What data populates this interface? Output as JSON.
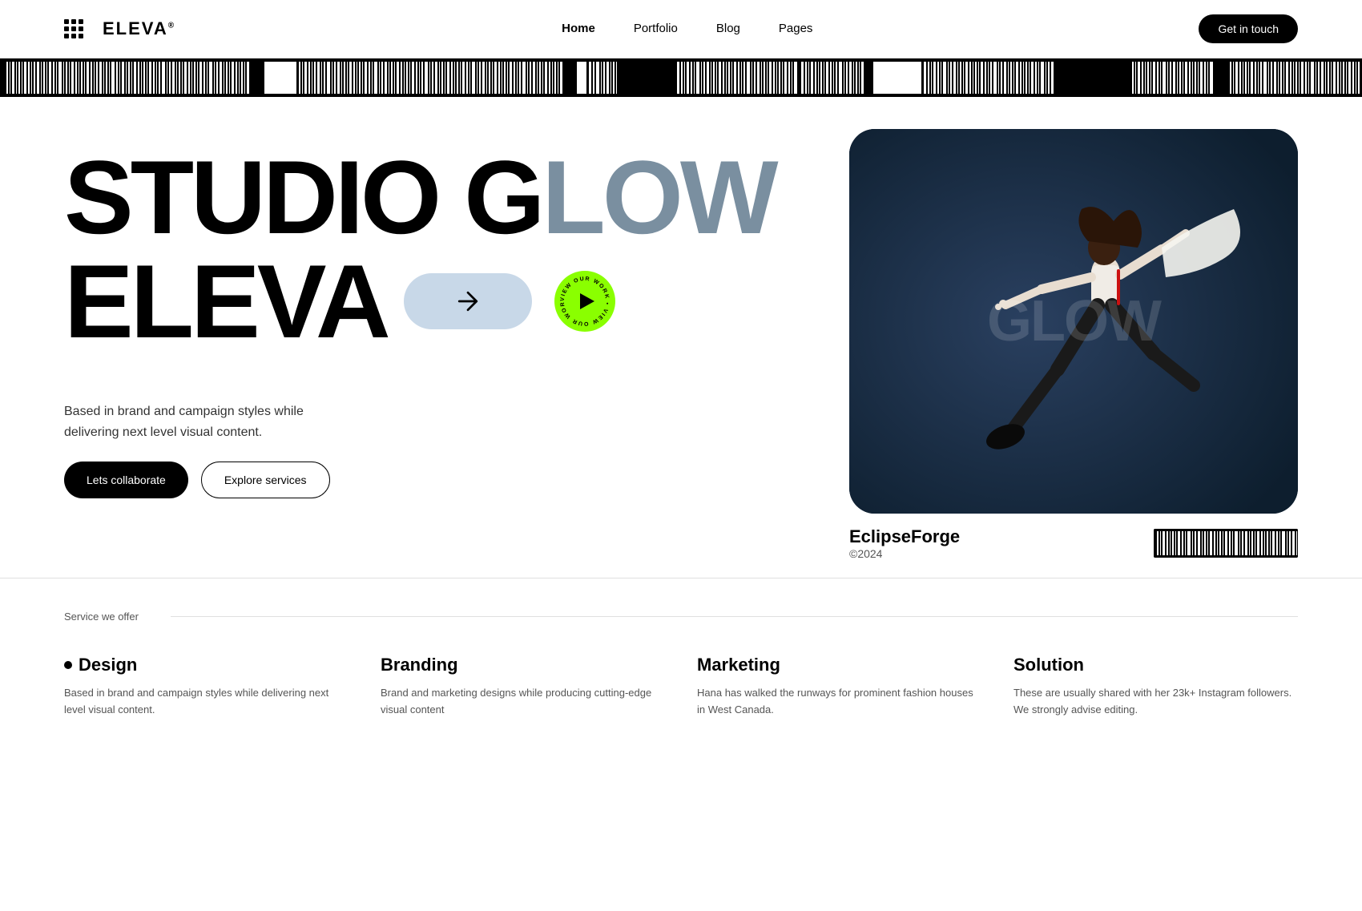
{
  "nav": {
    "logo": "ELEVA",
    "logo_sup": "®",
    "links": [
      {
        "label": "Home",
        "active": true
      },
      {
        "label": "Portfolio",
        "active": false
      },
      {
        "label": "Blog",
        "active": false
      },
      {
        "label": "Pages",
        "active": false
      }
    ],
    "cta_label": "Get in touch"
  },
  "hero": {
    "title_line1_part1": "STUDIO G",
    "title_line1_part2": "LOW",
    "title_line2": "ELEVA",
    "description": "Based in brand and campaign styles while delivering next level visual content.",
    "btn_collaborate": "Lets collaborate",
    "btn_services": "Explore services",
    "play_badge_text": "VIEW OUR WORK",
    "image_caption_title": "EclipseForge",
    "image_caption_year": "©2024",
    "image_overlay_text": "GLOW"
  },
  "services": {
    "section_label": "Service we offer",
    "items": [
      {
        "title": "Design",
        "has_bullet": true,
        "desc": "Based in brand and campaign styles while delivering next level visual content."
      },
      {
        "title": "Branding",
        "has_bullet": false,
        "desc": "Brand and marketing designs while producing cutting-edge visual content"
      },
      {
        "title": "Marketing",
        "has_bullet": false,
        "desc": "Hana has walked the runways for prominent fashion houses in West Canada."
      },
      {
        "title": "Solution",
        "has_bullet": false,
        "desc": "These are usually shared with her 23k+ Instagram followers. We strongly advise editing."
      }
    ]
  }
}
